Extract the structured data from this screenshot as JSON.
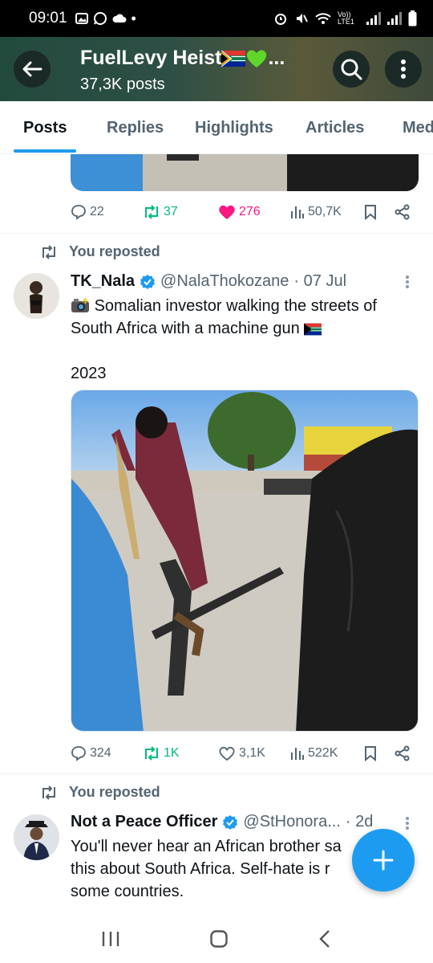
{
  "status_bar": {
    "time": "09:01",
    "network_label": "Vo)) LTE1"
  },
  "header": {
    "title": "FuelLevy Heist",
    "title_emojis": [
      "south-africa-flag",
      "green-heart"
    ],
    "title_ellipsis": "...",
    "subtitle": "37,3K posts"
  },
  "tabs": [
    {
      "label": "Posts",
      "active": true
    },
    {
      "label": "Replies",
      "active": false
    },
    {
      "label": "Highlights",
      "active": false
    },
    {
      "label": "Articles",
      "active": false
    },
    {
      "label": "Media",
      "active": false
    }
  ],
  "posts": [
    {
      "actions": {
        "replies": "22",
        "reposts": "37",
        "likes": "276",
        "views": "50,7K",
        "liked": true
      }
    },
    {
      "repost_label": "You reposted",
      "author_name": "TK_Nala",
      "handle": "@NalaThokozane",
      "date": "· 07 Jul",
      "text_line1": "Somalian investor walking the streets of",
      "text_line2": "South Africa with a machine gun",
      "text_line3": "2023",
      "actions": {
        "replies": "324",
        "reposts": "1K",
        "likes": "3,1K",
        "views": "522K",
        "liked": false
      }
    },
    {
      "repost_label": "You reposted",
      "author_name": "Not a Peace Officer",
      "handle": "@StHonora...",
      "date": "· 2d",
      "text_line1": "You'll never hear an African brother sa",
      "text_line2": "this about South Africa. Self-hate is r",
      "text_line3": "some countries."
    }
  ],
  "colors": {
    "accent": "#1d9bf0",
    "retweet": "#00ba7c",
    "like": "#f91880",
    "secondary_text": "#536471"
  }
}
